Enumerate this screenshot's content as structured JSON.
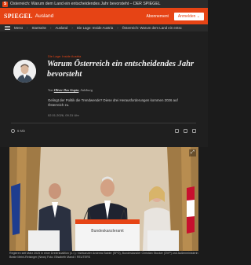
{
  "browser": {
    "tab_title": "Österreich: Warum dem Land ein entscheidendes Jahr bevorsteht – DER SPIEGEL",
    "favicon_letter": "S"
  },
  "header": {
    "logo": "SPIEGEL",
    "section": "Ausland",
    "abo_label": "Abonnement",
    "login_label": "Anmelden ⌄"
  },
  "breadcrumb": {
    "menu_label": "Menü",
    "items": [
      "Startseite",
      "Ausland",
      "Die Lage: Inside Austria",
      "Österreich: Warum dem Land ein entsc"
    ]
  },
  "article": {
    "kicker": "Die Lage: Inside Austria",
    "headline": "Warum Österreich ein entscheidendes Jahr bevorsteht",
    "byline_prefix": "Von",
    "author": "Oliver Das Gupta",
    "byline_suffix": ", Salzburg",
    "teaser": "Gelingt der Politik die Trendwende? Diese drei Herausforderungen kommen 2026 auf Österreich zu.",
    "date": "02.01.2026, 09.31 Uhr",
    "read_time": "6 Min"
  },
  "photo": {
    "podium_text": "Bundeskanzleramt"
  },
  "caption": {
    "text": "Regieren seit März 2025 in einer Dreierkoalition (v. l.): Vizekanzler Andreas Babler (SPÖ), Bundeskanzler Christian Stocker (ÖVP) und Außenministerin Beate Meinl-Reisinger (Neos)   Foto: Elisabeth Mandl / REUTERS"
  },
  "colors": {
    "brand": "#e64415",
    "background": "#1f1f1f"
  }
}
